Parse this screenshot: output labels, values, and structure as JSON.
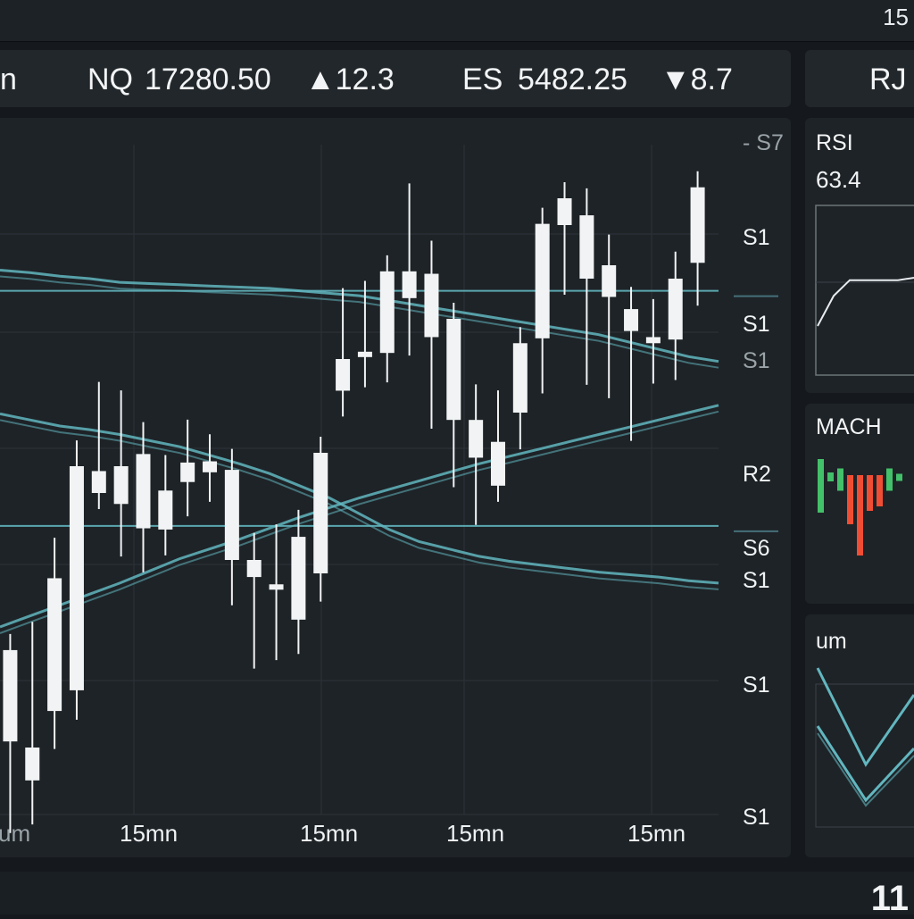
{
  "topbar": {
    "right_number": "15"
  },
  "ticker": {
    "left_fragment": "n",
    "nq_symbol": "NQ",
    "nq_price": "17280.50",
    "nq_change": "▲12.3",
    "es_symbol": "ES",
    "es_price": "5482.25",
    "es_change": "▼8.7",
    "right_fragment": "RJ"
  },
  "main_chart": {
    "y_labels": [
      "- S7",
      "S1",
      "S1",
      "S1",
      "R2",
      "S6",
      "S1",
      "S1",
      "S1"
    ],
    "x_labels": [
      "um",
      "15mn",
      "15mn",
      "15mn",
      "15mn"
    ],
    "line_color": "#62b6bf",
    "candle_color": "#f1f3f4"
  },
  "rsi_panel": {
    "title": "RSI",
    "value": "63.4"
  },
  "macd_panel": {
    "title": "MACH",
    "up_color": "#43c06a",
    "down_color": "#ef4d34"
  },
  "third_panel": {
    "title": "um"
  },
  "bottombar": {
    "right_number": "11"
  },
  "chart_data": {
    "type": "candlestick",
    "candles": [
      {
        "o": 5310,
        "h": 5385,
        "l": 5248,
        "c": 5385
      },
      {
        "o": 5278,
        "h": 5395,
        "l": 5255,
        "c": 5305
      },
      {
        "o": 5335,
        "h": 5464,
        "l": 5317,
        "c": 5444
      },
      {
        "o": 5352,
        "h": 5544,
        "l": 5341,
        "c": 5536
      },
      {
        "o": 5514,
        "h": 5592,
        "l": 5526,
        "c": 5532
      },
      {
        "o": 5536,
        "h": 5585,
        "l": 5475,
        "c": 5505
      },
      {
        "o": 5485,
        "h": 5559,
        "l": 5462,
        "c": 5546
      },
      {
        "o": 5484,
        "h": 5532,
        "l": 5476,
        "c": 5516
      },
      {
        "o": 5539,
        "h": 5561,
        "l": 5508,
        "c": 5523
      },
      {
        "o": 5531,
        "h": 5549,
        "l": 5520,
        "c": 5540
      },
      {
        "o": 5533,
        "h": 5537,
        "l": 5435,
        "c": 5459
      },
      {
        "o": 5445,
        "h": 5468,
        "l": 5383,
        "c": 5459
      },
      {
        "o": 5439,
        "h": 5475,
        "l": 5390,
        "c": 5435
      },
      {
        "o": 5410,
        "h": 5487,
        "l": 5395,
        "c": 5478
      },
      {
        "o": 5448,
        "h": 5502,
        "l": 5438,
        "c": 5547
      },
      {
        "o": 5598,
        "h": 5669,
        "l": 5590,
        "c": 5624
      },
      {
        "o": 5627,
        "h": 5675,
        "l": 5614,
        "c": 5630
      },
      {
        "o": 5629,
        "h": 5696,
        "l": 5618,
        "c": 5696
      },
      {
        "o": 5674,
        "h": 5755,
        "l": 5640,
        "c": 5696
      },
      {
        "o": 5694,
        "h": 5708,
        "l": 5580,
        "c": 5642
      },
      {
        "o": 5657,
        "h": 5626,
        "l": 5532,
        "c": 5574
      },
      {
        "o": 5574,
        "h": 5590,
        "l": 5501,
        "c": 5543
      },
      {
        "o": 5556,
        "h": 5585,
        "l": 5527,
        "c": 5520
      },
      {
        "o": 5580,
        "h": 5634,
        "l": 5563,
        "c": 5637
      },
      {
        "o": 5641,
        "h": 5728,
        "l": 5609,
        "c": 5735
      },
      {
        "o": 5734,
        "h": 5750,
        "l": 5690,
        "c": 5756
      },
      {
        "o": 5742,
        "h": 5751,
        "l": 5616,
        "c": 5690
      },
      {
        "o": 5701,
        "h": 5713,
        "l": 5605,
        "c": 5675
      },
      {
        "o": 5647,
        "h": 5670,
        "l": 5570,
        "c": 5665
      },
      {
        "o": 5642,
        "h": 5660,
        "l": 5617,
        "c": 5637
      },
      {
        "o": 5640,
        "h": 5699,
        "l": 5620,
        "c": 5690
      },
      {
        "o": 5703,
        "h": 5756,
        "l": 5681,
        "c": 5765
      }
    ],
    "series": [
      {
        "values": [
          5697,
          5695,
          5692,
          5690,
          5687,
          5686,
          5685,
          5684,
          5683,
          5682,
          5680,
          5678,
          5676,
          5672,
          5668,
          5664,
          5660,
          5656,
          5652,
          5648,
          5644,
          5638,
          5632,
          5626,
          5622
        ]
      },
      {
        "values": [
          5579,
          5574,
          5569,
          5566,
          5562,
          5557,
          5552,
          5545,
          5538,
          5530,
          5520,
          5510,
          5497,
          5484,
          5474,
          5468,
          5462,
          5458,
          5455,
          5452,
          5449,
          5447,
          5445,
          5442,
          5440
        ]
      },
      {
        "values": [
          5404,
          5413,
          5422,
          5431,
          5440,
          5450,
          5460,
          5468,
          5476,
          5485,
          5494,
          5502,
          5510,
          5517,
          5524,
          5531,
          5538,
          5544,
          5550,
          5556,
          5562,
          5568,
          5574,
          5580,
          5586
        ]
      }
    ],
    "hlines": [
      5680,
      5487
    ],
    "rsi": [
      20,
      45,
      58,
      58,
      58,
      58,
      60
    ],
    "macd": [
      {
        "v": 0.6,
        "up": true
      },
      {
        "v": 0.1,
        "up": true
      },
      {
        "v": 0.25,
        "up": true
      },
      {
        "v": 0.55,
        "up": false
      },
      {
        "v": 0.9,
        "up": false
      },
      {
        "v": 0.4,
        "up": false
      },
      {
        "v": 0.35,
        "up": false
      },
      {
        "v": 0.25,
        "up": true
      },
      {
        "v": 0.05,
        "up": true
      }
    ]
  }
}
